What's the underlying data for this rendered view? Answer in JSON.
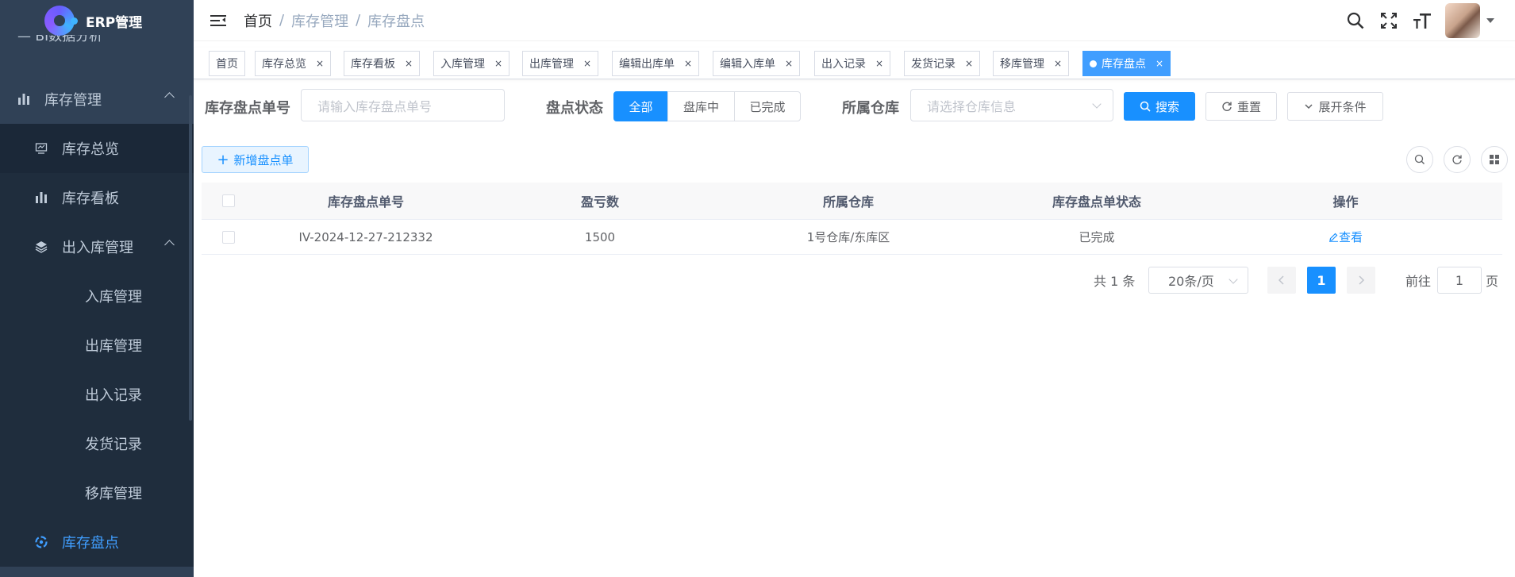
{
  "app": {
    "title": "ERP管理",
    "accent": "#1890ff",
    "sidebar_bg": "#304156"
  },
  "sidebar": {
    "cut_item": "BI数据分析",
    "items": [
      {
        "label": "库存管理",
        "icon": "bar-chart-icon",
        "level": 1
      },
      {
        "label": "库存总览",
        "icon": "monitor-icon",
        "level": 2
      },
      {
        "label": "库存看板",
        "icon": "bar-chart-icon",
        "level": 2
      },
      {
        "label": "出入库管理",
        "icon": "layers-icon",
        "level": 2
      },
      {
        "label": "入库管理",
        "level": 3
      },
      {
        "label": "出库管理",
        "level": 3
      },
      {
        "label": "出入记录",
        "level": 3
      },
      {
        "label": "发货记录",
        "level": 3
      },
      {
        "label": "移库管理",
        "level": 3
      },
      {
        "label": "库存盘点",
        "icon": "target-icon",
        "level": 2
      }
    ]
  },
  "header": {
    "breadcrumb": [
      "首页",
      "库存管理",
      "库存盘点"
    ],
    "sep": "/"
  },
  "tags": [
    {
      "label": "首页"
    },
    {
      "label": "库存总览"
    },
    {
      "label": "库存看板"
    },
    {
      "label": "入库管理"
    },
    {
      "label": "出库管理"
    },
    {
      "label": "编辑出库单"
    },
    {
      "label": "编辑入库单"
    },
    {
      "label": "出入记录"
    },
    {
      "label": "发货记录"
    },
    {
      "label": "移库管理"
    },
    {
      "label": "库存盘点"
    }
  ],
  "tag_close": "×",
  "form": {
    "order_label": "库存盘点单号",
    "order_placeholder": "请输入库存盘点单号",
    "status_label": "盘点状态",
    "status_options": [
      "全部",
      "盘库中",
      "已完成"
    ],
    "warehouse_label": "所属仓库",
    "warehouse_placeholder": "请选择仓库信息",
    "search": "搜索",
    "reset": "重置",
    "expand": "展开条件"
  },
  "toolbar": {
    "add": "新增盘点单"
  },
  "table": {
    "columns": [
      "库存盘点单号",
      "盈亏数",
      "所属仓库",
      "库存盘点单状态",
      "操作"
    ],
    "rows": [
      {
        "no": "IV-2024-12-27-212332",
        "diff": "1500",
        "warehouse": "1号仓库/东库区",
        "status": "已完成",
        "action": "查看"
      }
    ]
  },
  "pagination": {
    "total": "共 1 条",
    "page_size": "20条/页",
    "current": "1",
    "goto_prefix": "前往",
    "goto_value": "1",
    "goto_suffix": "页"
  }
}
